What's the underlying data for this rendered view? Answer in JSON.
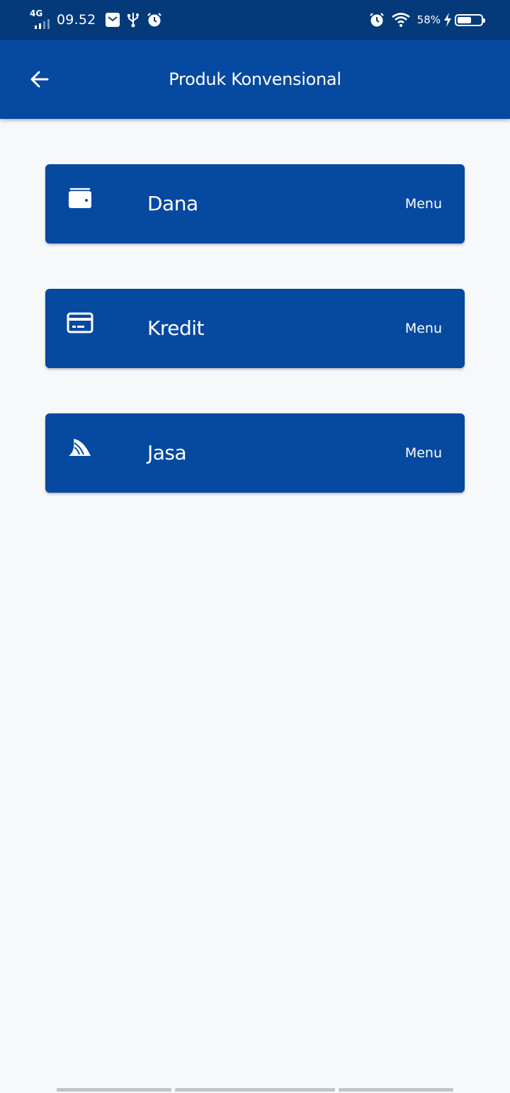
{
  "status_bar": {
    "network": "4G",
    "time": "09.52",
    "battery_percent": "58%",
    "battery_level": 0.58,
    "icons": [
      "mail-icon",
      "usb-icon",
      "alarm-icon",
      "alarm-icon",
      "wifi-icon",
      "charging-icon",
      "battery-icon"
    ]
  },
  "app_bar": {
    "title": "Produk Konvensional",
    "back_icon": "arrow-left-icon"
  },
  "menu_items": [
    {
      "label": "Dana",
      "action": "Menu",
      "icon": "wallet-icon"
    },
    {
      "label": "Kredit",
      "action": "Menu",
      "icon": "credit-card-icon"
    },
    {
      "label": "Jasa",
      "action": "Menu",
      "icon": "shark-fin-icon"
    }
  ],
  "colors": {
    "status_bar": "#053a7a",
    "primary": "#0649a1",
    "background": "#f7f8f9",
    "on_primary": "#ffffff",
    "indicator": "#c2c4c7"
  }
}
